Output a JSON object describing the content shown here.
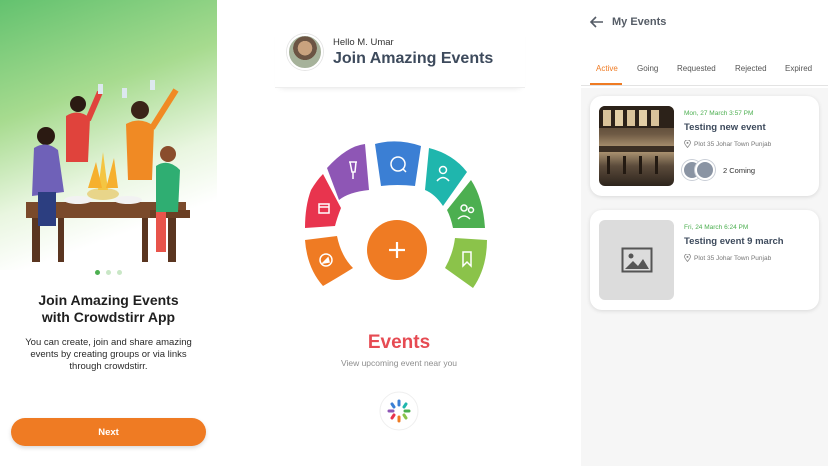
{
  "onboarding": {
    "title_line1": "Join Amazing Events",
    "title_line2": "with Crowdstirr App",
    "description": "You can create, join and share amazing events by creating groups or via links through crowdstirr.",
    "next_label": "Next",
    "page_count": 3,
    "active_page": 1
  },
  "home": {
    "greeting": "Hello M. Umar",
    "title": "Join Amazing Events",
    "events_title": "Events",
    "events_subtitle": "View upcoming event near you",
    "radial_items": [
      {
        "icon": "flag-icon",
        "color": "#8e56b5"
      },
      {
        "icon": "chat-icon",
        "color": "#3b7fd4"
      },
      {
        "icon": "user-icon",
        "color": "#1fb6ad"
      },
      {
        "icon": "calendar-icon",
        "color": "#e8344e"
      },
      {
        "icon": "group-icon",
        "color": "#4caf50"
      },
      {
        "icon": "compass-icon",
        "color": "#ef7b23"
      },
      {
        "icon": "bookmark-icon",
        "color": "#8bc34a"
      }
    ],
    "center_button_icon": "plus-icon",
    "center_button_color": "#ef7b23"
  },
  "my_events": {
    "title": "My Events",
    "tabs": [
      "Active",
      "Going",
      "Requested",
      "Rejected",
      "Expired"
    ],
    "active_tab": "Active",
    "events": [
      {
        "date": "Mon, 27 March 3:57 PM",
        "title": "Testing new event",
        "location": "Plot 35 Johar Town  Punjab",
        "coming": "2 Coming"
      },
      {
        "date": "Fri, 24 March 6:24 PM",
        "title": "Testing event 9 march",
        "location": "Plot 35 Johar Town  Punjab"
      }
    ]
  },
  "colors": {
    "accent_orange": "#ef7b23",
    "accent_green": "#4caf50",
    "accent_red": "#e64b53",
    "heading_slate": "#3d4a5c"
  }
}
